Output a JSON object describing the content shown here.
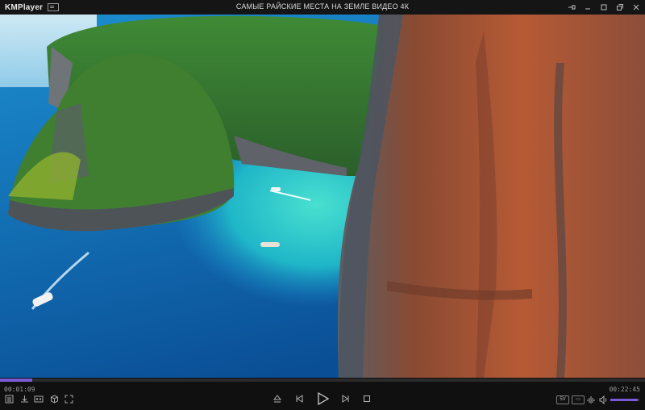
{
  "app": {
    "name": "KMPlayer",
    "title": "САМЫЕ РАЙСКИЕ МЕСТА НА ЗЕМЛЕ ВИДЕО 4К"
  },
  "window_controls": [
    "pin-icon",
    "minimize-icon",
    "maximize-icon",
    "restore-icon",
    "close-icon"
  ],
  "playback": {
    "current_time": "00:01:09",
    "total_time": "00:22:45",
    "progress_fraction": 0.05,
    "volume_fraction": 0.95
  },
  "left_tools": [
    "playlist-icon",
    "download-icon",
    "capture-icon",
    "3d-icon",
    "fullscreen-icon"
  ],
  "transport": [
    "eject-icon",
    "previous-icon",
    "play-icon",
    "next-icon",
    "stop-icon"
  ],
  "right_tools": {
    "badge1": "5V",
    "badge2": "▭",
    "eq": "eq-icon",
    "speaker": "speaker-icon"
  },
  "colors": {
    "accent": "#7a5bd6",
    "bar": "#151515",
    "sea": "#0b6fb8",
    "lagoon": "#25c6c0",
    "cliff": "#b85a34"
  }
}
